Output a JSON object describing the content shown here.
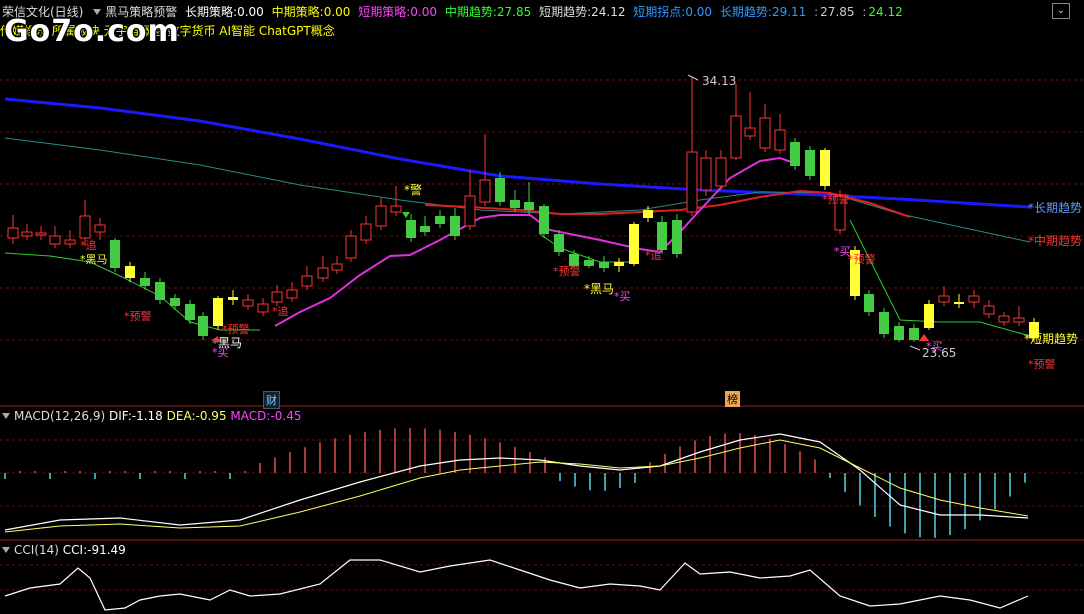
{
  "header": {
    "stock": "荣信文化(日线)",
    "indicator": "黑马策略预警",
    "long_label": "长期策略:",
    "long_value": "0.00",
    "mid_label": "中期策略:",
    "mid_value": "0.00",
    "short_label": "短期策略:",
    "short_value": "0.00",
    "mid_trend_label": "中期趋势:",
    "mid_trend_value": "27.85",
    "short_trend_label": "短期趋势:",
    "short_trend_value": "24.12",
    "short_pivot_label": "短期拐点:",
    "short_pivot_value": "0.00",
    "long_trend_label": "长期趋势:",
    "long_trend_value": "29.11",
    "long_trend_v2": "27.85",
    "long_trend_v3": "24.12",
    "close_icon": "chevron-down-icon"
  },
  "concepts": "传媒娱乐 所属板块 元宇宙概念 数字货币 AI智能 ChatGPT概念",
  "watermark": "Go7o.com",
  "main_chart": {
    "high_label": "34.13",
    "low_label": "23.65",
    "long_trend_tag": "*长期趋势",
    "mid_trend_tag": "*中期趋势",
    "short_trend_tag": "*短期趋势",
    "signals": {
      "zhui1": "*追",
      "heima1": "*黑马",
      "yujing1": "*预警",
      "heima2": "*黑马",
      "mai1": "*买",
      "yujing2": "*预警",
      "zhui2": "*追",
      "jing": "*警",
      "yujing3": "*预警",
      "heima3": "*黑马",
      "mai2": "*买",
      "zhui3": "*追",
      "jing2": "*预警",
      "mai3": "*买",
      "yujing4": "*预警",
      "mai4": "*买",
      "yujing5": "*预警"
    },
    "events": {
      "cai": "财",
      "bang": "榜"
    },
    "colors": {
      "long": "#1a1aff",
      "mid": "#e02020",
      "short": "#e030e0",
      "up": "#ff3333",
      "down": "#44cc44",
      "flat": "#ffff33"
    }
  },
  "macd": {
    "label": "MACD(12,26,9)",
    "dif_label": "DIF:",
    "dif_value": "-1.18",
    "dea_label": "DEA:",
    "dea_value": "-0.95",
    "macd_label": "MACD:",
    "macd_value": "-0.45"
  },
  "cci": {
    "label": "CCI(14)",
    "cci_label": "CCI:",
    "cci_value": "-91.49"
  }
}
